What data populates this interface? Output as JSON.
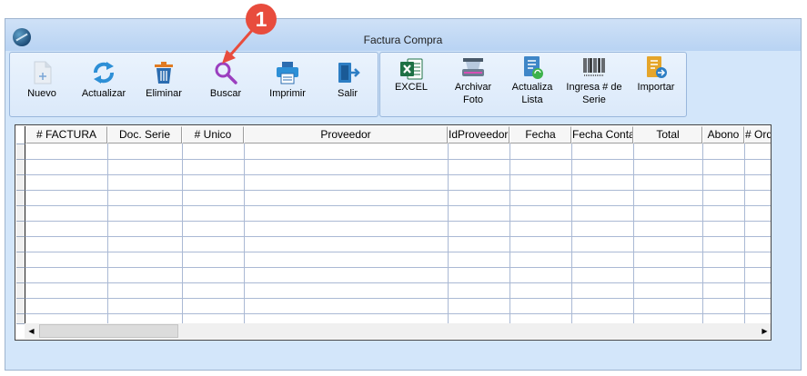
{
  "window": {
    "title": "Factura Compra"
  },
  "toolbar_main": [
    {
      "label": "Nuevo",
      "icon": "new-document-icon"
    },
    {
      "label": "Actualizar",
      "icon": "refresh-icon"
    },
    {
      "label": "Eliminar",
      "icon": "trash-icon"
    },
    {
      "label": "Buscar",
      "icon": "search-icon"
    },
    {
      "label": "Imprimir",
      "icon": "printer-icon"
    },
    {
      "label": "Salir",
      "icon": "exit-icon"
    }
  ],
  "toolbar_extra": [
    {
      "label": "EXCEL",
      "icon": "excel-icon"
    },
    {
      "label_line1": "Archivar",
      "label_line2": "Foto",
      "icon": "scanner-icon"
    },
    {
      "label_line1": "Actualiza",
      "label_line2": "Lista",
      "icon": "update-list-icon"
    },
    {
      "label_line1": "Ingresa # de",
      "label_line2": "Serie",
      "icon": "barcode-icon"
    },
    {
      "label": "Importar",
      "icon": "import-icon"
    }
  ],
  "grid": {
    "columns": [
      "# FACTURA",
      "Doc. Serie",
      "# Unico",
      "Proveedor",
      "IdProveedor",
      "Fecha",
      "Fecha Conta",
      "Total",
      "Abono",
      "# Ord"
    ],
    "rows": []
  },
  "callout": {
    "number": "1"
  },
  "colors": {
    "accent_badge": "#e84c3d",
    "window_bg": "#d3e6fa",
    "grid_line": "#aab9d4"
  }
}
